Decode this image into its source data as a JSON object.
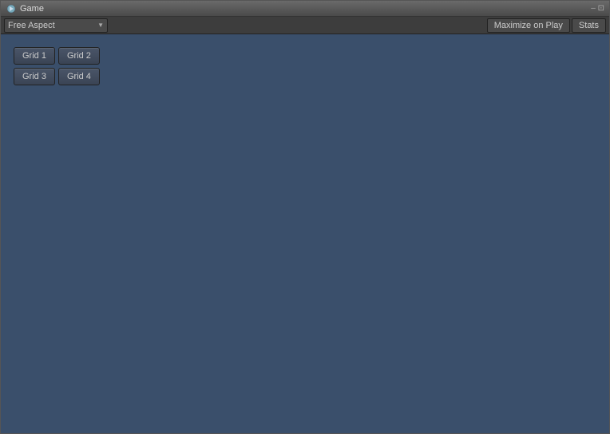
{
  "window": {
    "title": "Game"
  },
  "title_bar": {
    "title": "Game",
    "controls": "– ⊡"
  },
  "toolbar": {
    "aspect_label": "Free Aspect",
    "maximize_btn": "Maximize on Play",
    "stats_btn": "Stats"
  },
  "grid_buttons": [
    {
      "label": "Grid 1",
      "id": "grid1"
    },
    {
      "label": "Grid 2",
      "id": "grid2"
    },
    {
      "label": "Grid 3",
      "id": "grid3"
    },
    {
      "label": "Grid 4",
      "id": "grid4"
    }
  ]
}
